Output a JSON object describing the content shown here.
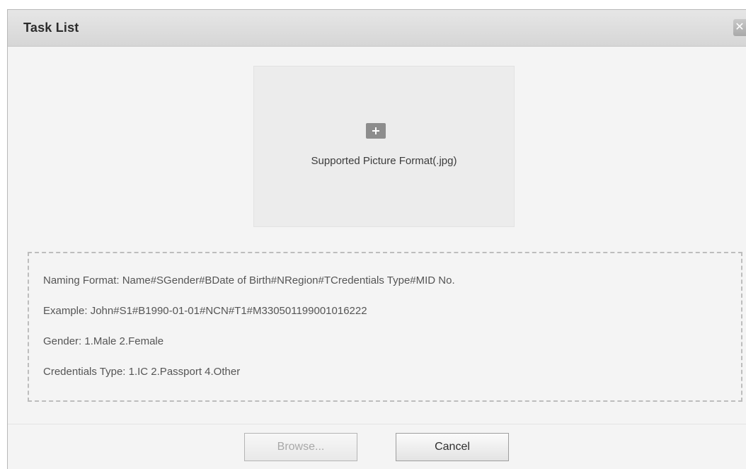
{
  "dialog": {
    "title": "Task List",
    "close_glyph": "✕",
    "close_icon": "close-icon"
  },
  "upload": {
    "icon": "plus-icon",
    "hint": "Supported Picture Format(.jpg)"
  },
  "info": {
    "lines": [
      "Naming Format:  Name#SGender#BDate of Birth#NRegion#TCredentials Type#MID No.",
      "Example: John#S1#B1990-01-01#NCN#T1#M330501199001016222",
      "Gender: 1.Male 2.Female",
      "Credentials Type:  1.IC 2.Passport 4.Other"
    ]
  },
  "buttons": {
    "browse": {
      "label": "Browse...",
      "enabled": false
    },
    "cancel": {
      "label": "Cancel",
      "enabled": true
    }
  }
}
